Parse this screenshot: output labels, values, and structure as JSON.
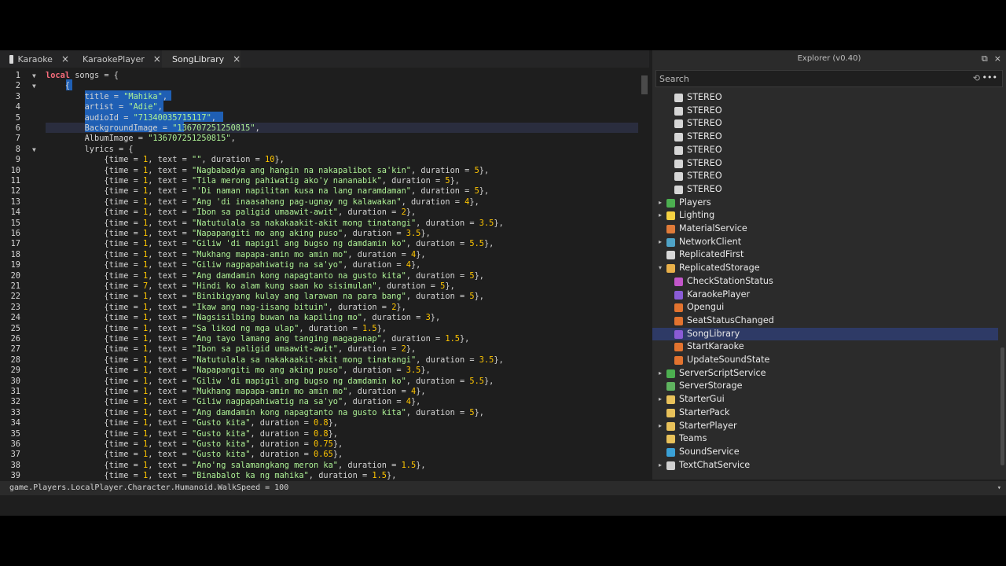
{
  "tabs": [
    {
      "label": "Karaoke",
      "icon": "local-script-icon",
      "active": false
    },
    {
      "label": "KaraokePlayer",
      "icon": "module-script-icon",
      "active": false
    },
    {
      "label": "SongLibrary",
      "icon": "module-script-icon",
      "active": true
    }
  ],
  "editor": {
    "lines": [
      "local songs = {",
      "    {",
      "        title = \"Mahika\",",
      "        artist = \"Adie\",",
      "        audioId = \"71340035715117\",",
      "        BackgroundImage = \"136707251250815\",",
      "        AlbumImage = \"136707251250815\",",
      "        lyrics = {",
      "            {time = 1, text = \"\", duration = 10},",
      "            {time = 1, text = \"Nagbabadya ang hangin na nakapalibot sa'kin\", duration = 5},",
      "            {time = 1, text = \"Tila merong pahiwatig ako'y nananabik\", duration = 5},",
      "            {time = 1, text = \"'Di naman napilitan kusa na lang naramdaman\", duration = 5},",
      "            {time = 1, text = \"Ang 'di inaasahang pag-ugnay ng kalawakan\", duration = 4},",
      "            {time = 1, text = \"Ibon sa paligid umaawit-awit\", duration = 2},",
      "            {time = 1, text = \"Natutulala sa nakakaakit-akit mong tinatangi\", duration = 3.5},",
      "            {time = 1, text = \"Napapangiti mo ang aking puso\", duration = 3.5},",
      "            {time = 1, text = \"Giliw 'di mapigil ang bugso ng damdamin ko\", duration = 5.5},",
      "            {time = 1, text = \"Mukhang mapapa-amin mo amin mo\", duration = 4},",
      "            {time = 1, text = \"Giliw nagpapahiwatig na sa'yo\", duration = 4},",
      "            {time = 1, text = \"Ang damdamin kong napagtanto na gusto kita\", duration = 5},",
      "            {time = 7, text = \"Hindi ko alam kung saan ko sisimulan\", duration = 5},",
      "            {time = 1, text = \"Binibigyang kulay ang larawan na para bang\", duration = 5},",
      "            {time = 1, text = \"Ikaw ang nag-iisang bituin\", duration = 2},",
      "            {time = 1, text = \"Nagsisilbing buwan na kapiling mo\", duration = 3},",
      "            {time = 1, text = \"Sa likod ng mga ulap\", duration = 1.5},",
      "            {time = 1, text = \"Ang tayo lamang ang tanging magaganap\", duration = 1.5},",
      "            {time = 1, text = \"Ibon sa paligid umaawit-awit\", duration = 2},",
      "            {time = 1, text = \"Natutulala sa nakakaakit-akit mong tinatangi\", duration = 3.5},",
      "            {time = 1, text = \"Napapangiti mo ang aking puso\", duration = 3.5},",
      "            {time = 1, text = \"Giliw 'di mapigil ang bugso ng damdamin ko\", duration = 5.5},",
      "            {time = 1, text = \"Mukhang mapapa-amin mo amin mo\", duration = 4},",
      "            {time = 1, text = \"Giliw nagpapahiwatig na sa'yo\", duration = 4},",
      "            {time = 1, text = \"Ang damdamin kong napagtanto na gusto kita\", duration = 5},",
      "            {time = 1, text = \"Gusto kita\", duration = 0.8},",
      "            {time = 1, text = \"Gusto kita\", duration = 0.8},",
      "            {time = 1, text = \"Gusto kita\", duration = 0.75},",
      "            {time = 1, text = \"Gusto kita\", duration = 0.65},",
      "            {time = 1, text = \"Ano'ng salamangkang meron ka\", duration = 1.5},",
      "            {time = 1, text = \"Binabalot ka ng mahika\", duration = 1.5},"
    ]
  },
  "command_bar": {
    "text": "game.Players.LocalPlayer.Character.Humanoid.WalkSpeed = 100"
  },
  "explorer": {
    "title": "Explorer (v0.40)",
    "search_placeholder": "Search",
    "items": [
      {
        "label": "STEREO",
        "icon": "sound-icon",
        "depth": 2,
        "toggle": ""
      },
      {
        "label": "STEREO",
        "icon": "sound-icon",
        "depth": 2,
        "toggle": ""
      },
      {
        "label": "STEREO",
        "icon": "sound-icon",
        "depth": 2,
        "toggle": ""
      },
      {
        "label": "STEREO",
        "icon": "sound-icon",
        "depth": 2,
        "toggle": ""
      },
      {
        "label": "STEREO",
        "icon": "sound-icon",
        "depth": 2,
        "toggle": ""
      },
      {
        "label": "STEREO",
        "icon": "sound-icon",
        "depth": 2,
        "toggle": ""
      },
      {
        "label": "STEREO",
        "icon": "sound-icon",
        "depth": 2,
        "toggle": ""
      },
      {
        "label": "STEREO",
        "icon": "sound-icon",
        "depth": 2,
        "toggle": ""
      },
      {
        "label": "Players",
        "icon": "players-icon",
        "depth": 1,
        "toggle": "collapsed"
      },
      {
        "label": "Lighting",
        "icon": "lighting-icon",
        "depth": 1,
        "toggle": "collapsed"
      },
      {
        "label": "MaterialService",
        "icon": "material-service-icon",
        "depth": 1,
        "toggle": ""
      },
      {
        "label": "NetworkClient",
        "icon": "network-icon",
        "depth": 1,
        "toggle": "collapsed"
      },
      {
        "label": "ReplicatedFirst",
        "icon": "replicated-first-icon",
        "depth": 1,
        "toggle": ""
      },
      {
        "label": "ReplicatedStorage",
        "icon": "replicated-storage-icon",
        "depth": 1,
        "toggle": "expanded"
      },
      {
        "label": "CheckStationStatus",
        "icon": "remote-function-icon",
        "depth": 2,
        "toggle": ""
      },
      {
        "label": "KaraokePlayer",
        "icon": "module-script-icon",
        "depth": 2,
        "toggle": ""
      },
      {
        "label": "Opengui",
        "icon": "remote-event-icon",
        "depth": 2,
        "toggle": ""
      },
      {
        "label": "SeatStatusChanged",
        "icon": "remote-event-icon",
        "depth": 2,
        "toggle": ""
      },
      {
        "label": "SongLibrary",
        "icon": "module-script-icon",
        "depth": 2,
        "toggle": "",
        "selected": true
      },
      {
        "label": "StartKaraoke",
        "icon": "remote-event-icon",
        "depth": 2,
        "toggle": ""
      },
      {
        "label": "UpdateSoundState",
        "icon": "remote-event-icon",
        "depth": 2,
        "toggle": ""
      },
      {
        "label": "ServerScriptService",
        "icon": "server-script-service-icon",
        "depth": 1,
        "toggle": "collapsed"
      },
      {
        "label": "ServerStorage",
        "icon": "server-storage-icon",
        "depth": 1,
        "toggle": ""
      },
      {
        "label": "StarterGui",
        "icon": "starter-gui-icon",
        "depth": 1,
        "toggle": "collapsed"
      },
      {
        "label": "StarterPack",
        "icon": "starter-pack-icon",
        "depth": 1,
        "toggle": ""
      },
      {
        "label": "StarterPlayer",
        "icon": "starter-player-icon",
        "depth": 1,
        "toggle": "collapsed"
      },
      {
        "label": "Teams",
        "icon": "teams-icon",
        "depth": 1,
        "toggle": ""
      },
      {
        "label": "SoundService",
        "icon": "sound-service-icon",
        "depth": 1,
        "toggle": ""
      },
      {
        "label": "TextChatService",
        "icon": "text-chat-service-icon",
        "depth": 1,
        "toggle": "collapsed"
      }
    ]
  },
  "colors": {
    "keyword": "#f86d7c",
    "string": "#adf195",
    "number": "#ffc600",
    "selection": "#1f5fb4",
    "explorer_selected": "#2e3a66"
  }
}
